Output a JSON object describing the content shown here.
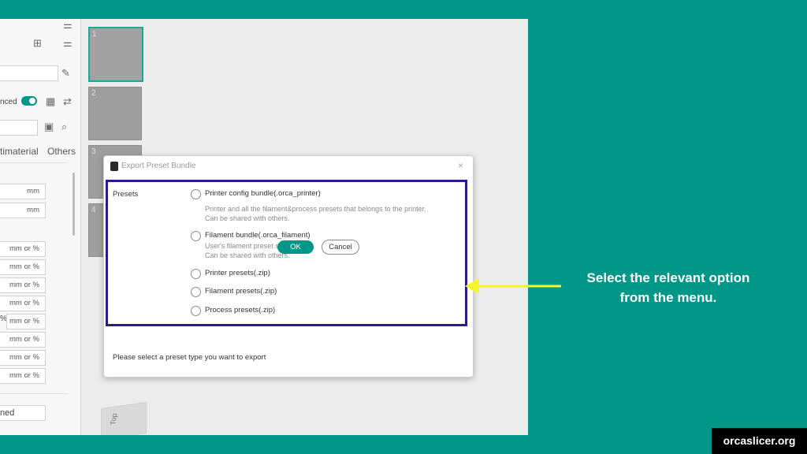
{
  "left_panel": {
    "advanced_label": "nced",
    "tabs": [
      "timaterial",
      "Others"
    ],
    "units": [
      "mm",
      "mm",
      "mm or %",
      "mm or %",
      "mm or %",
      "mm or %",
      "mm or %",
      "mm or %",
      "mm or %",
      "mm or %"
    ],
    "percent_sign": "%",
    "bottom_value": "ned"
  },
  "plates": [
    "1",
    "2",
    "3",
    "4"
  ],
  "view_cube_label": "Top",
  "dialog": {
    "title": "Export Preset Bundle",
    "close": "×",
    "presets_label": "Presets",
    "options": [
      {
        "label": "Printer config bundle(.orca_printer)",
        "desc": [
          "Printer and all the filament&process presets that belongs to the printer.",
          "Can be shared with others."
        ]
      },
      {
        "label": "Filament bundle(.orca_filament)",
        "desc": [
          "User's filament preset set.",
          "Can be shared with others."
        ]
      },
      {
        "label": "Printer presets(.zip)",
        "desc": []
      },
      {
        "label": "Filament presets(.zip)",
        "desc": []
      },
      {
        "label": "Process presets(.zip)",
        "desc": []
      }
    ],
    "status": "Please select a preset type you want to export",
    "ok_label": "OK",
    "cancel_label": "Cancel"
  },
  "callout": {
    "line1": "Select the relevant option",
    "line2": "from the menu."
  },
  "brand": "orcaslicer.org",
  "colors": {
    "accent": "#009688",
    "highlight": "#2a1a8c",
    "arrow": "#f5f52a"
  }
}
